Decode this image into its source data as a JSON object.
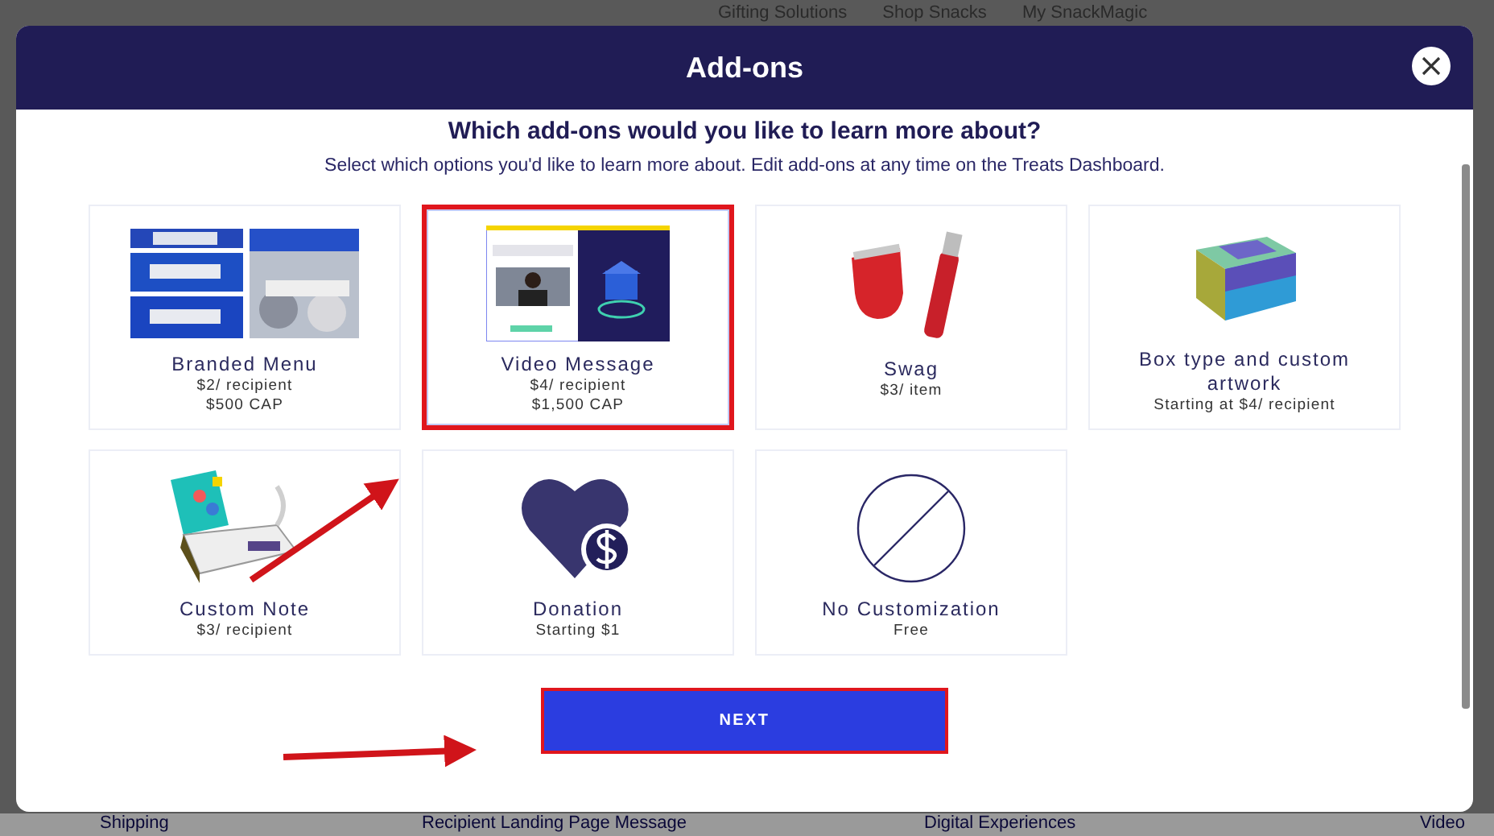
{
  "background_page": {
    "nav_links": [
      "Gifting Solutions",
      "Shop Snacks",
      "My SnackMagic"
    ],
    "section_tabs": [
      "Shipping",
      "Recipient Landing Page Message",
      "Digital Experiences",
      "Video"
    ]
  },
  "modal": {
    "title": "Add-ons",
    "heading": "Which add-ons would you like to learn more about?",
    "subtitle": "Select which options you'd like to learn more about. Edit add-ons at any time on the Treats Dashboard.",
    "addons": [
      {
        "kind": "branded-menu",
        "name": "Branded Menu",
        "price_lines": [
          "$2/ recipient",
          "$500 CAP"
        ],
        "selected": false
      },
      {
        "kind": "video",
        "name": "Video Message",
        "price_lines": [
          "$4/ recipient",
          "$1,500 CAP"
        ],
        "selected": true
      },
      {
        "kind": "swag",
        "name": "Swag",
        "price_lines": [
          "$3/ item"
        ],
        "selected": false
      },
      {
        "kind": "box",
        "name": "Box type and custom artwork",
        "price_lines": [
          "Starting at $4/ recipient"
        ],
        "selected": false
      },
      {
        "kind": "note",
        "name": "Custom Note",
        "price_lines": [
          "$3/ recipient"
        ],
        "selected": false
      },
      {
        "kind": "donation",
        "name": "Donation",
        "price_lines": [
          "Starting $1"
        ],
        "selected": false
      },
      {
        "kind": "none",
        "name": "No Customization",
        "price_lines": [
          "Free"
        ],
        "selected": false
      }
    ],
    "next_button": {
      "label": "NEXT",
      "highlighted": true
    }
  }
}
